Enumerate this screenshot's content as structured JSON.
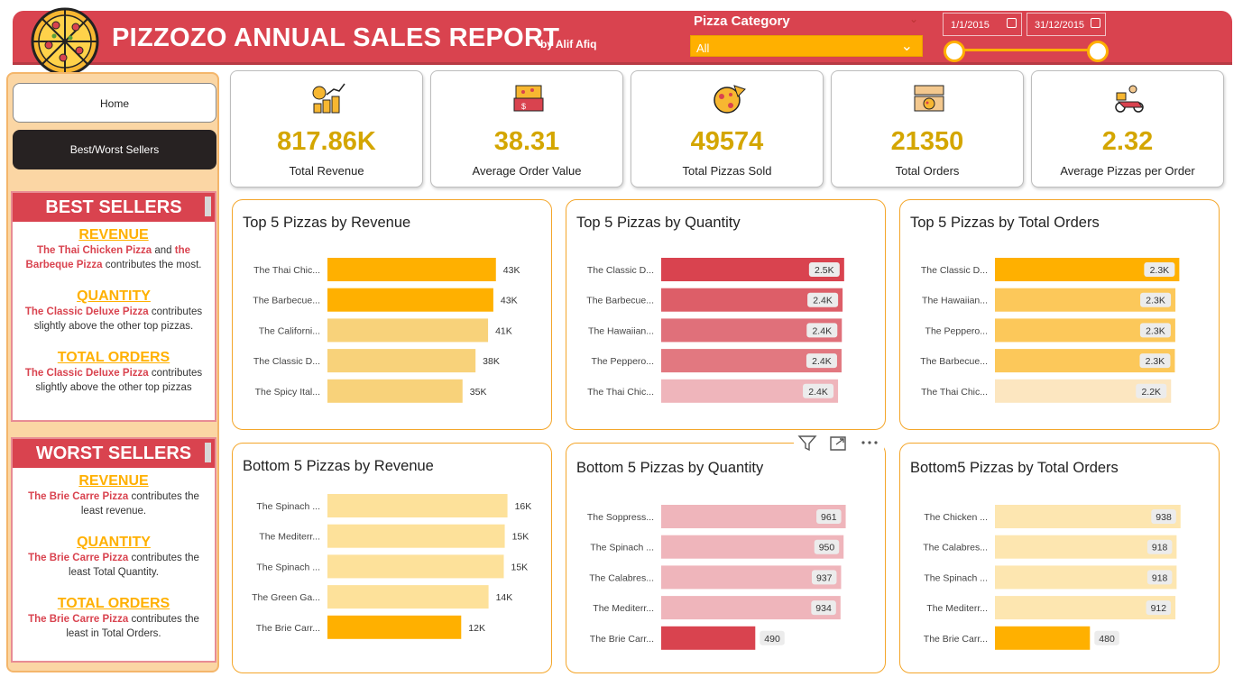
{
  "header": {
    "title": "PIZZOZO ANNUAL SALES REPORT",
    "byline": "by Alif Afiq",
    "category_label": "Pizza Category",
    "category_value": "All",
    "date_start": "1/1/2015",
    "date_end": "31/12/2015",
    "colors": {
      "banner": "#d9434f",
      "accent": "#ffb000"
    }
  },
  "nav": {
    "home": "Home",
    "best_worst": "Best/Worst Sellers"
  },
  "best": {
    "heading": "BEST SELLERS",
    "revenue_title": "REVENUE",
    "revenue_pizza1": "The Thai Chicken Pizza",
    "revenue_and": " and ",
    "revenue_pizza2": "the Barbeque Pizza",
    "revenue_rest": " contributes the most.",
    "quantity_title": "QUANTITY",
    "quantity_pizza": "The Classic Deluxe Pizza",
    "quantity_rest": " contributes slightly above the other top pizzas.",
    "orders_title": "TOTAL ORDERS",
    "orders_pizza": "The Classic Deluxe Pizza",
    "orders_rest": " contributes slightly above the other top pizzas"
  },
  "worst": {
    "heading": "WORST SELLERS",
    "revenue_title": "REVENUE",
    "revenue_pizza": "The Brie Carre Pizza",
    "revenue_rest": " contributes the least revenue.",
    "quantity_title": "QUANTITY",
    "quantity_pizza": "The Brie Carre Pizza",
    "quantity_rest": " contributes the least Total Quantity.",
    "orders_title": "TOTAL ORDERS",
    "orders_pizza": "The Brie Carre Pizza",
    "orders_rest": " contributes the least in Total Orders."
  },
  "kpis": [
    {
      "value": "817.86K",
      "label": "Total Revenue",
      "icon": "money-icon"
    },
    {
      "value": "38.31",
      "label": "Average Order Value",
      "icon": "pizza-box-icon"
    },
    {
      "value": "49574",
      "label": "Total Pizzas Sold",
      "icon": "pizza-icon"
    },
    {
      "value": "21350",
      "label": "Total Orders",
      "icon": "open-box-icon"
    },
    {
      "value": "2.32",
      "label": "Average Pizzas per Order",
      "icon": "delivery-icon"
    }
  ],
  "chart_data": [
    {
      "type": "bar",
      "title": "Top 5 Pizzas by Revenue",
      "categories": [
        "The Thai Chic...",
        "The Barbecue...",
        "The Californi...",
        "The Classic D...",
        "The Spicy Ital..."
      ],
      "values": [
        43434,
        42768,
        41410,
        38180,
        34831
      ],
      "labels": [
        "43K",
        "43K",
        "41K",
        "38K",
        "35K"
      ],
      "xlim": [
        0,
        50000
      ],
      "colors": [
        "#ffb000",
        "#ffb000",
        "#f8d27a",
        "#f8d27a",
        "#f8d27a"
      ],
      "label_style": "outside"
    },
    {
      "type": "bar",
      "title": "Top 5 Pizzas by Quantity",
      "categories": [
        "The Classic D...",
        "The Barbecue...",
        "The Hawaiian...",
        "The Peppero...",
        "The Thai Chic..."
      ],
      "values": [
        2453,
        2432,
        2422,
        2418,
        2371
      ],
      "labels": [
        "2.5K",
        "2.4K",
        "2.4K",
        "2.4K",
        "2.4K"
      ],
      "xlim": [
        0,
        2600
      ],
      "colors": [
        "#d9434f",
        "#dd5e68",
        "#e0707a",
        "#e27880",
        "#efb5bb"
      ],
      "label_style": "inside"
    },
    {
      "type": "bar",
      "title": "Top 5 Pizzas by Total Orders",
      "categories": [
        "The Classic D...",
        "The Hawaiian...",
        "The Peppero...",
        "The Barbecue...",
        "The Thai Chic..."
      ],
      "values": [
        2329,
        2280,
        2278,
        2273,
        2225
      ],
      "labels": [
        "2.3K",
        "2.3K",
        "2.3K",
        "2.3K",
        "2.2K"
      ],
      "xlim": [
        0,
        2450
      ],
      "colors": [
        "#ffb000",
        "#fcc85a",
        "#fcc85a",
        "#fcc85a",
        "#fce6c0"
      ],
      "label_style": "inside"
    },
    {
      "type": "bar",
      "title": "Bottom 5 Pizzas by Revenue",
      "categories": [
        "The Spinach ...",
        "The Mediterr...",
        "The Spinach ...",
        "The Green Ga...",
        "The Brie Carr..."
      ],
      "values": [
        15596,
        15360,
        15277,
        13956,
        11588
      ],
      "labels": [
        "16K",
        "15K",
        "15K",
        "14K",
        "12K"
      ],
      "xlim": [
        0,
        16800
      ],
      "colors": [
        "#fde19a",
        "#fde19a",
        "#fde19a",
        "#fde19a",
        "#ffb000"
      ],
      "label_style": "outside"
    },
    {
      "type": "bar",
      "title": "Bottom 5 Pizzas by Quantity",
      "categories": [
        "The Soppress...",
        "The Spinach ...",
        "The Calabres...",
        "The Mediterr...",
        "The Brie Carr..."
      ],
      "values": [
        961,
        950,
        937,
        934,
        490
      ],
      "labels": [
        "961",
        "950",
        "937",
        "934",
        "490"
      ],
      "xlim": [
        0,
        1010
      ],
      "colors": [
        "#efb5bb",
        "#efb5bb",
        "#efb5bb",
        "#efb5bb",
        "#d9434f"
      ],
      "label_style": "mixed"
    },
    {
      "type": "bar",
      "title": "Bottom5 Pizzas by Total Orders",
      "categories": [
        "The Chicken ...",
        "The Calabres...",
        "The Spinach ...",
        "The Mediterr...",
        "The Brie Carr..."
      ],
      "values": [
        938,
        918,
        918,
        912,
        480
      ],
      "labels": [
        "938",
        "918",
        "918",
        "912",
        "480"
      ],
      "xlim": [
        0,
        980
      ],
      "colors": [
        "#fde6b0",
        "#fde6b0",
        "#fde6b0",
        "#fde6b0",
        "#ffb000"
      ],
      "label_style": "mixed"
    }
  ]
}
